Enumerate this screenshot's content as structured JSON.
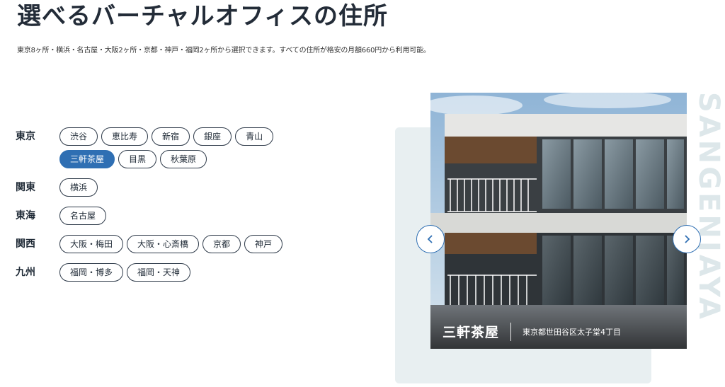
{
  "header": {
    "title": "選べるバーチャルオフィスの住所",
    "subtitle": "東京8ヶ所・横浜・名古屋・大阪2ヶ所・京都・神戸・福岡2ヶ所から選択できます。すべての住所が格安の月額660円から利用可能。"
  },
  "regions": [
    {
      "label": "東京",
      "areas": [
        "渋谷",
        "恵比寿",
        "新宿",
        "銀座",
        "青山",
        "三軒茶屋",
        "目黒",
        "秋葉原"
      ]
    },
    {
      "label": "関東",
      "areas": [
        "横浜"
      ]
    },
    {
      "label": "東海",
      "areas": [
        "名古屋"
      ]
    },
    {
      "label": "関西",
      "areas": [
        "大阪・梅田",
        "大阪・心斎橋",
        "京都",
        "神戸"
      ]
    },
    {
      "label": "九州",
      "areas": [
        "福岡・博多",
        "福岡・天神"
      ]
    }
  ],
  "selected_area": "三軒茶屋",
  "slide": {
    "name": "三軒茶屋",
    "address": "東京都世田谷区太子堂4丁目",
    "vertical_text": "SANGENJAYA"
  },
  "icons": {
    "prev": "chevron-left-icon",
    "next": "chevron-right-icon"
  },
  "colors": {
    "accent": "#2f6fb3",
    "panel_bg": "#e8eff1",
    "text": "#1f2a36"
  }
}
